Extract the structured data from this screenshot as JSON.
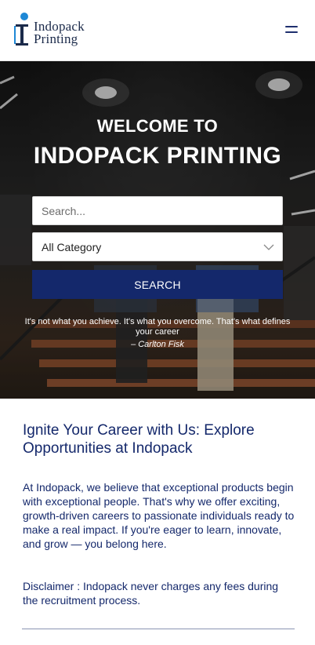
{
  "header": {
    "logo_line1": "Indopack",
    "logo_line2": "Printing",
    "brand_color": "#1b2a4a",
    "menu_icon": "hamburger-icon"
  },
  "hero": {
    "welcome": "WELCOME TO",
    "company": "INDOPACK PRINTING",
    "search": {
      "placeholder": "Search...",
      "value": ""
    },
    "category": {
      "selected": "All Category"
    },
    "search_button": "SEARCH",
    "quote": "It's not what you achieve. It's what you overcome. That's what defines your career",
    "quote_author": "– Carlton Fisk",
    "accent_color": "#14286b"
  },
  "main": {
    "title": "Ignite Your Career with Us: Explore Opportunities at Indopack",
    "intro": "At Indopack, we believe that exceptional products begin with exceptional people. That's why we offer exciting, growth-driven careers to passionate individuals ready to make a real impact. If you're eager to learn, innovate, and grow — you belong here.",
    "disclaimer": "Disclaimer : Indopack never charges any fees during the recruitment process."
  }
}
